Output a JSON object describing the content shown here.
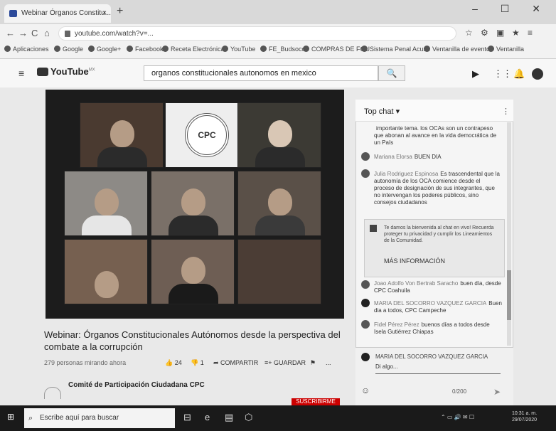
{
  "browser": {
    "tab_title": "Webinar Órganos Constitu...",
    "tab_close": "×",
    "new_tab": "+",
    "window_controls": "– ☐ ✕",
    "url": "youtube.com/watch?v=...",
    "nav": {
      "back": "←",
      "forward": "→",
      "reload": "C",
      "home": "⌂"
    },
    "extensions": [
      "☆",
      "⚙",
      "▣",
      "★",
      "≡"
    ],
    "bookmarks": [
      "Aplicaciones",
      "Google",
      "Google+",
      "Facebook",
      "Receta Electrónica",
      "YouTube",
      "FE_Budsoco",
      "COMPRAS DE FOU..",
      "Sistema Penal Acus..",
      "Ventanilla de eventos",
      "Ventanilla"
    ]
  },
  "youtube": {
    "logo": "YouTube",
    "logo_region": "MX",
    "search_query": "organos constitucionales autonomos en mexico",
    "search_icon": "🔍",
    "header_icons": [
      "▶",
      "⋮⋮",
      "🔔"
    ]
  },
  "video": {
    "logo_text": "CPC",
    "title": "Webinar: Órganos Constitucionales Autónomos desde la perspectiva del combate a la corrupción",
    "views": "279 personas mirando ahora",
    "likes": "24",
    "dislikes": "1",
    "share_label": "COMPARTIR",
    "save_label": "GUARDAR",
    "more": "...",
    "channel": "Comité de Participación Ciudadana CPC",
    "subscribe": "SUSCRIBIRME"
  },
  "chat": {
    "header": "Top chat ▾",
    "more": "⋮",
    "messages": [
      {
        "author": "",
        "text": "importante tema. los OCAs son un contrapeso que abonan al avance en la vida democrática de un País"
      },
      {
        "author": "Mariana Elorsa",
        "text": "BUEN DIA"
      },
      {
        "author": "Julia Rodriguez Espinosa",
        "text": "Es trascendental que la autonomía de los OCA comience desde el proceso de designación de sus integrantes, que no intervengan los poderes públicos, sino consejos ciudadanos"
      },
      {
        "author": "Joao Adolfo Von Bertrab Saracho",
        "text": "buen día, desde CPC Coahuila"
      },
      {
        "author": "MARIA DEL SOCORRO VAZQUEZ GARCIA",
        "text": "Buen dia a todos, CPC Campeche"
      },
      {
        "author": "Fidel Pérez Pérez",
        "text": "buenos días a todos desde Isela Gutiérrez Chiapas"
      }
    ],
    "banner_text": "Te damos la bienvenida al chat en vivo! Recuerda proteger tu privacidad y cumplir los Lineamientos de la Comunidad.",
    "banner_button": "MÁS INFORMACIÓN",
    "composer_author": "MARIA DEL SOCORRO VAZQUEZ GARCIA",
    "composer_placeholder": "Di algo...",
    "char_count": "0/200",
    "send": "➤",
    "emoji": "☺"
  },
  "taskbar": {
    "start": "⊞",
    "search_placeholder": "Escribe aquí para buscar",
    "apps": [
      "⊟",
      "e",
      "▤",
      "⬡"
    ],
    "systray": "⌃ ▭ 🔊 ✉ ☐",
    "time": "10:31 a. m.",
    "date": "29/07/2020"
  }
}
